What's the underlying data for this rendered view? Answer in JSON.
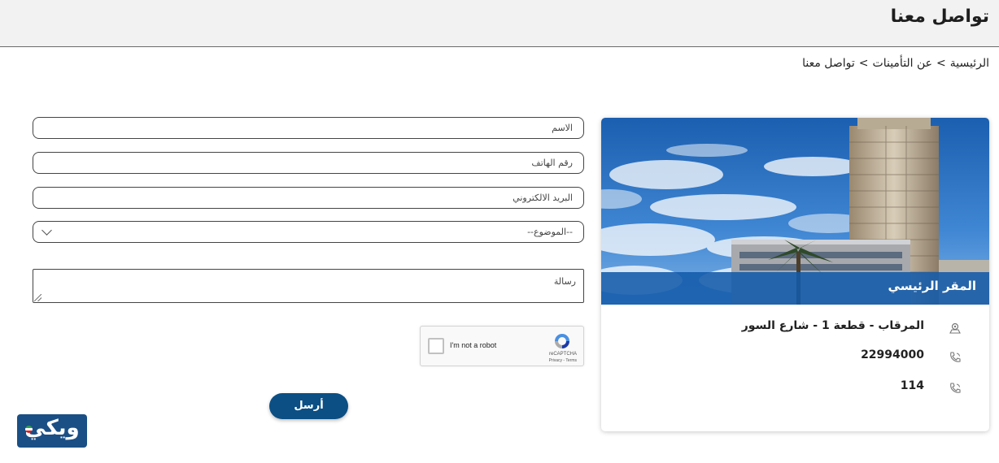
{
  "header": {
    "title": "تواصل معنا"
  },
  "breadcrumb": {
    "home": "الرئيسية",
    "about": "عن التأمينات",
    "current": "تواصل معنا",
    "separator": ">"
  },
  "form": {
    "name_placeholder": "الاسم",
    "phone_placeholder": "رقم الهاتف",
    "email_placeholder": "البريد الالكتروني",
    "subject_selected": "--الموضوع--",
    "message_placeholder": "رسالة",
    "captcha_label": "I'm not a robot",
    "captcha_brand": "reCAPTCHA",
    "captcha_links": "Privacy - Terms",
    "submit_label": "أرسل"
  },
  "office": {
    "title": "المقر الرئيسي",
    "address": "المرقاب - قطعة 1 - شارع السور",
    "phone": "22994000",
    "hotline": "114"
  },
  "watermark": {
    "text": "ويكي"
  },
  "colors": {
    "primary": "#0b4f84",
    "caption": "#125aaa",
    "header_bg": "#f2f2f2"
  },
  "icons": {
    "location": "map-pin-icon",
    "phone": "phone-icon",
    "hotline": "phone-icon",
    "select": "chevron-down-icon",
    "captcha": "recaptcha-logo-icon"
  }
}
